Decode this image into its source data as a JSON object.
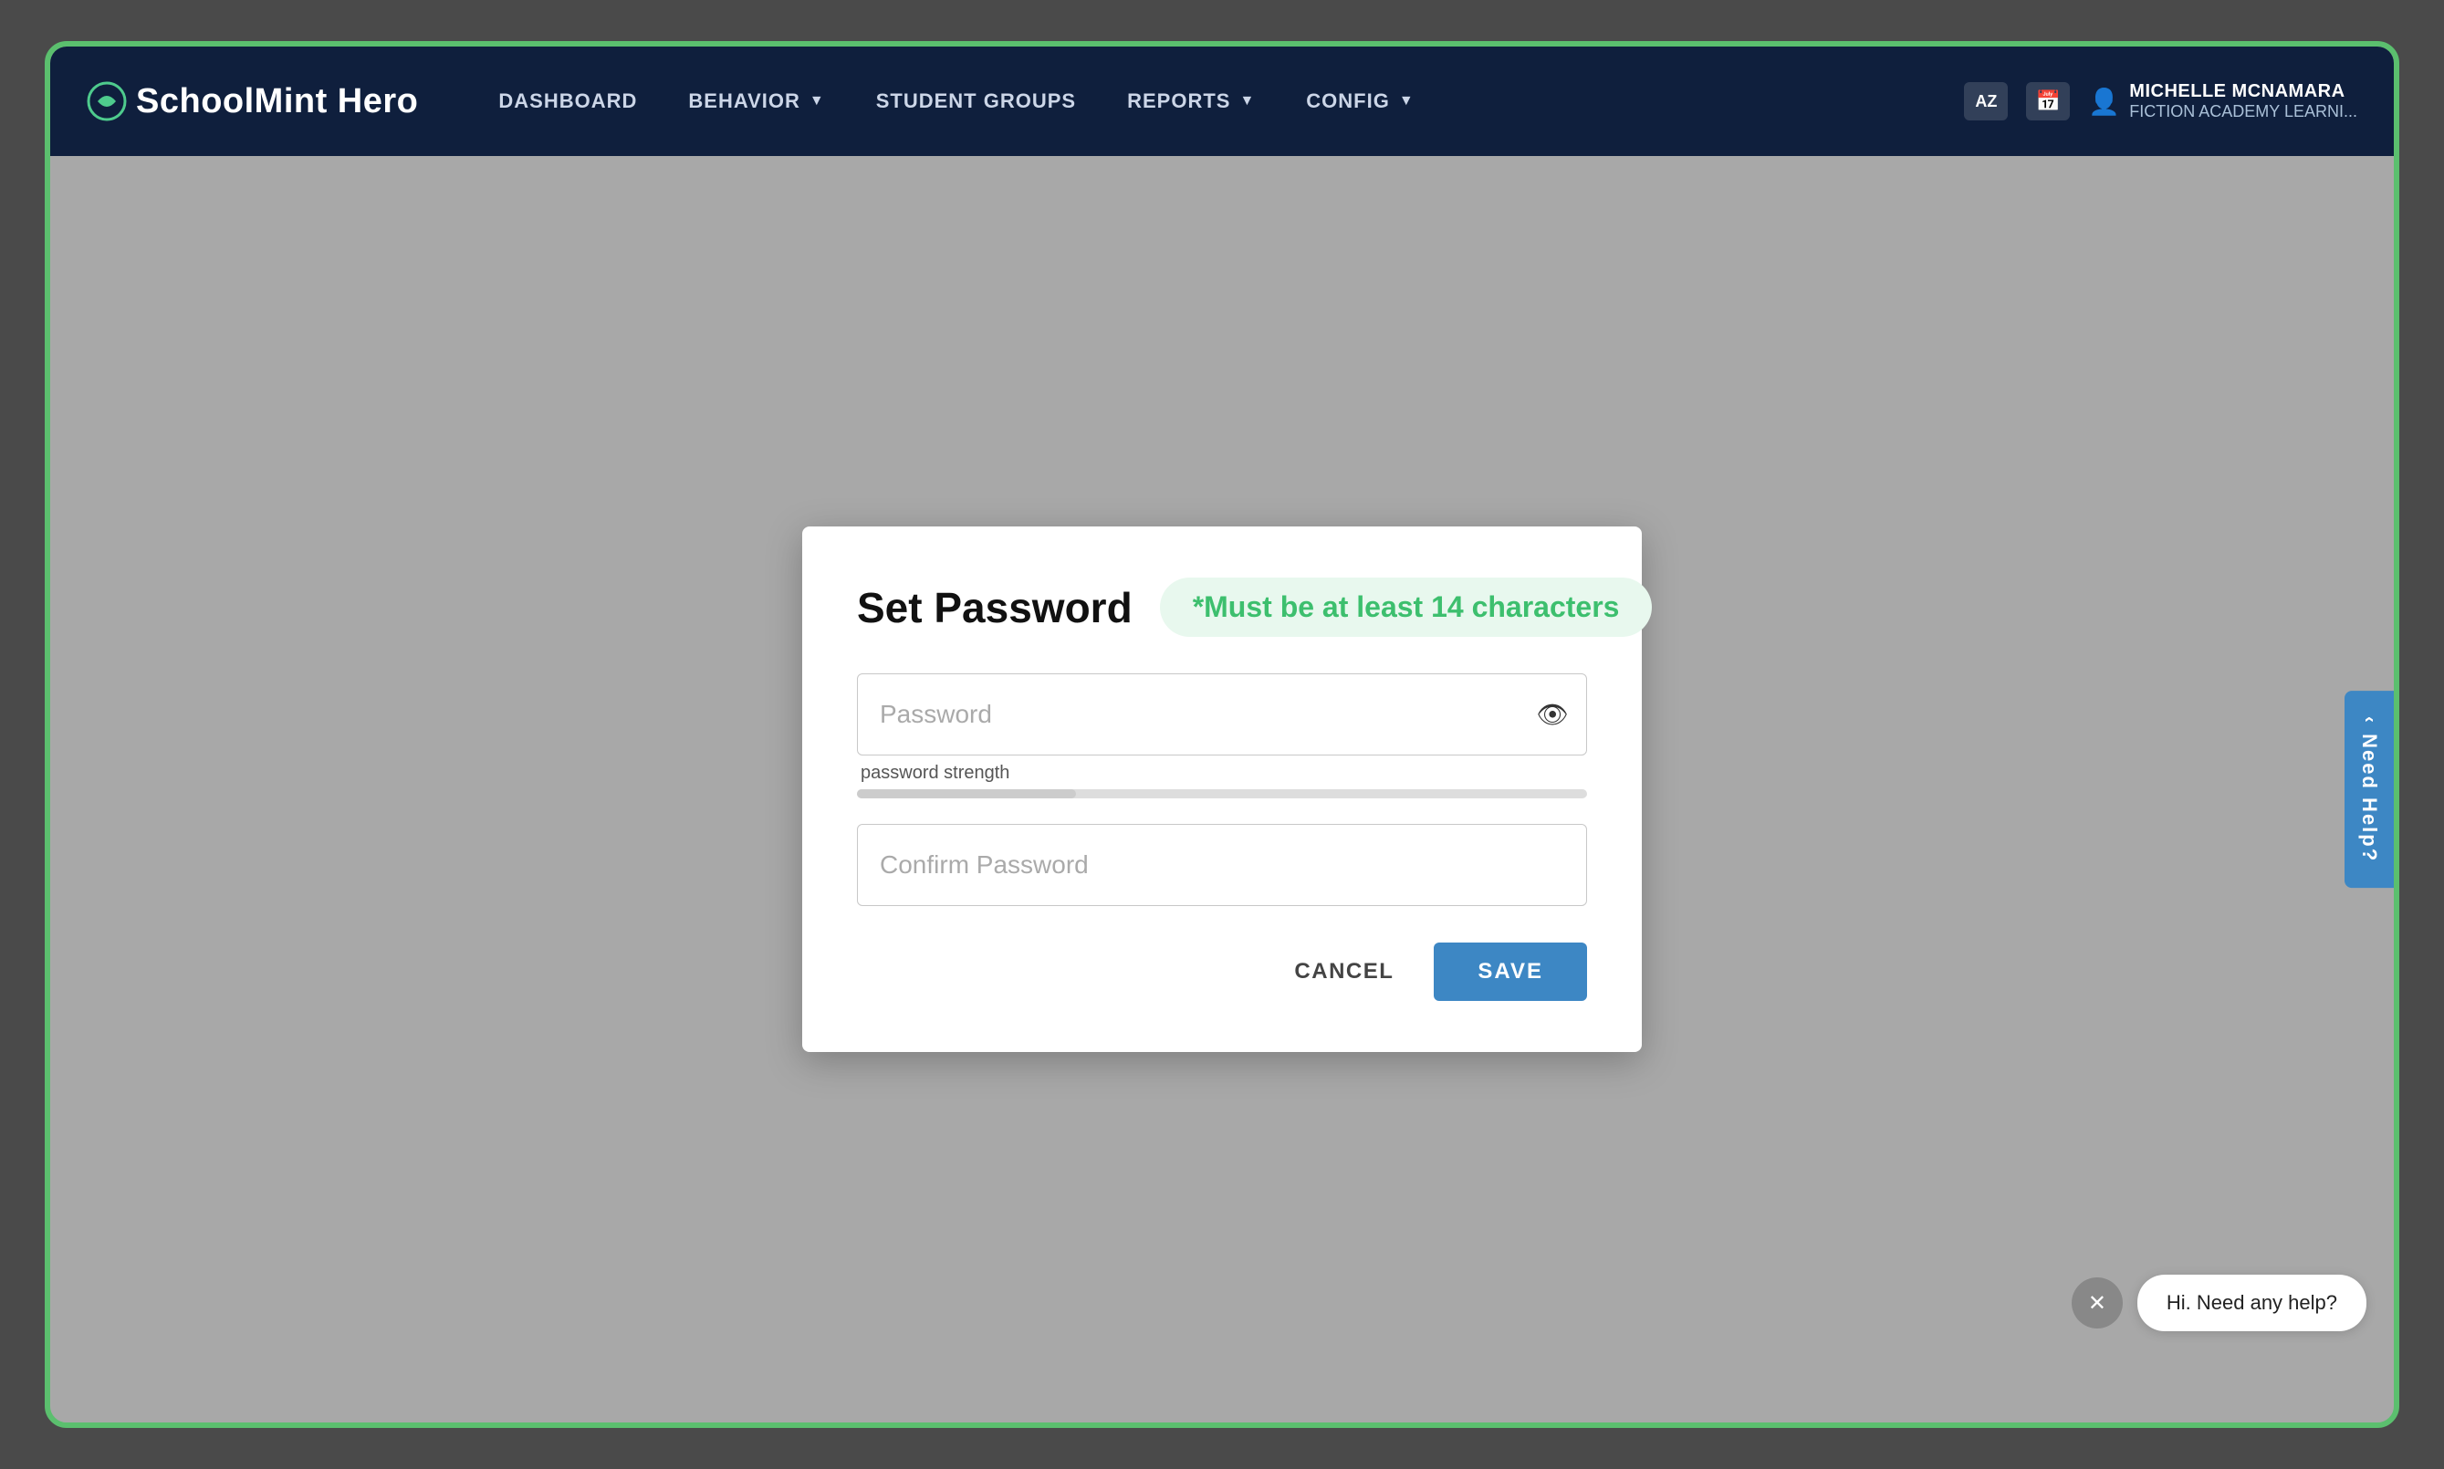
{
  "app": {
    "name": "SchoolMint Hero"
  },
  "navbar": {
    "logo_text_normal": "SchoolMint",
    "logo_text_bold": " Hero",
    "links": [
      {
        "label": "DASHBOARD",
        "has_caret": false
      },
      {
        "label": "BEHAVIOR",
        "has_caret": true
      },
      {
        "label": "STUDENT GROUPS",
        "has_caret": false
      },
      {
        "label": "REPORTS",
        "has_caret": true
      },
      {
        "label": "CONFIG",
        "has_caret": true
      }
    ],
    "icons": [
      {
        "name": "az-icon",
        "glyph": "AZ"
      },
      {
        "name": "calendar-icon",
        "glyph": "📅"
      }
    ],
    "user": {
      "name": "MICHELLE MCNAMARA",
      "school": "FICTION ACADEMY LEARNI..."
    }
  },
  "modal": {
    "title": "Set Password",
    "hint": "*Must be at least 14 characters",
    "password_placeholder": "Password",
    "strength_label": "password strength",
    "confirm_placeholder": "Confirm Password",
    "cancel_label": "CANCEL",
    "save_label": "SAVE"
  },
  "chat": {
    "tab_label": "Need Help?",
    "message": "Hi. Need any help?",
    "close_icon": "✕"
  }
}
